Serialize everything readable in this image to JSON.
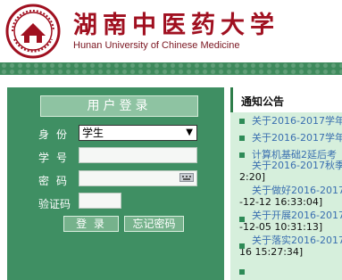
{
  "header": {
    "university_name_cn": "湖南中医药大学",
    "university_name_en": "Hunan University of Chinese Medicine"
  },
  "login": {
    "title": "用户登录",
    "identity_label": "身份",
    "identity_value": "学生",
    "student_id_label": "学号",
    "student_id_value": "",
    "password_label": "密码",
    "password_value": "",
    "captcha_label": "验证码",
    "captcha_value": "",
    "login_button": "登 录",
    "forgot_button": "忘记密码"
  },
  "notice": {
    "title": "通知公告",
    "items": [
      {
        "text": "关于2016-2017学年",
        "sub": ""
      },
      {
        "text": "关于2016-2017学年",
        "sub": ""
      },
      {
        "text": "计算机基础2延后考",
        "sub": ""
      },
      {
        "text": "关于2016-2017秋季",
        "sub": "2:20]"
      },
      {
        "text": "关于做好2016-2017",
        "sub": "-12-12 16:33:04]"
      },
      {
        "text": "关于开展2016-2017",
        "sub": "-12-05 10:31:13]"
      },
      {
        "text": "关于落实2016-2017",
        "sub": "16 15:27:34]"
      }
    ]
  },
  "colors": {
    "brand_red": "#a01020",
    "panel_green": "#3f8f63",
    "notice_bg": "#d6efdc",
    "link_blue": "#3a6fb0"
  },
  "icons": {
    "logo": "university-seal",
    "keyboard": "keyboard-icon",
    "select_arrow": "triangle-down"
  }
}
